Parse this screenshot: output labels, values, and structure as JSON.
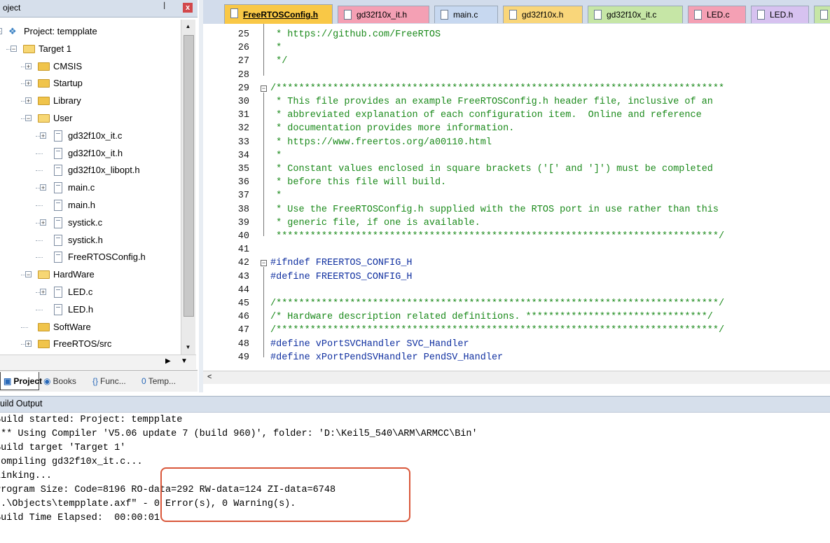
{
  "project_panel": {
    "title": "oject",
    "pin": "ꟾ",
    "close": "x",
    "tree": [
      {
        "label": "Project: tempplate",
        "type": "project",
        "level": 0,
        "expander": "-"
      },
      {
        "label": "Target 1",
        "type": "target",
        "level": 1,
        "expander": "-"
      },
      {
        "label": "CMSIS",
        "type": "folder",
        "level": 2,
        "expander": "+"
      },
      {
        "label": "Startup",
        "type": "folder",
        "level": 2,
        "expander": "+"
      },
      {
        "label": "Library",
        "type": "folder",
        "level": 2,
        "expander": "+"
      },
      {
        "label": "User",
        "type": "folder-open",
        "level": 2,
        "expander": "-"
      },
      {
        "label": "gd32f10x_it.c",
        "type": "file",
        "level": 3,
        "expander": "+"
      },
      {
        "label": "gd32f10x_it.h",
        "type": "file",
        "level": 3,
        "expander": ""
      },
      {
        "label": "gd32f10x_libopt.h",
        "type": "file",
        "level": 3,
        "expander": ""
      },
      {
        "label": "main.c",
        "type": "file",
        "level": 3,
        "expander": "+"
      },
      {
        "label": "main.h",
        "type": "file",
        "level": 3,
        "expander": ""
      },
      {
        "label": "systick.c",
        "type": "file",
        "level": 3,
        "expander": "+"
      },
      {
        "label": "systick.h",
        "type": "file",
        "level": 3,
        "expander": ""
      },
      {
        "label": "FreeRTOSConfig.h",
        "type": "file",
        "level": 3,
        "expander": ""
      },
      {
        "label": "HardWare",
        "type": "folder-open",
        "level": 2,
        "expander": "-"
      },
      {
        "label": "LED.c",
        "type": "file",
        "level": 3,
        "expander": "+"
      },
      {
        "label": "LED.h",
        "type": "file",
        "level": 3,
        "expander": ""
      },
      {
        "label": "SoftWare",
        "type": "folder",
        "level": 2,
        "expander": ""
      },
      {
        "label": "FreeRTOS/src",
        "type": "folder",
        "level": 2,
        "expander": "+"
      }
    ],
    "bottom_tabs": [
      {
        "label": "Project",
        "icon": "project-icon"
      },
      {
        "label": "Books",
        "icon": "books-icon"
      },
      {
        "label": "Func...",
        "icon": "functions-icon",
        "glyph": "{}"
      },
      {
        "label": "Temp...",
        "icon": "templates-icon",
        "glyph": "0"
      }
    ]
  },
  "editor": {
    "tabs": [
      {
        "label": "FreeRTOSConfig.h",
        "color": "#f9c846",
        "active": true
      },
      {
        "label": "gd32f10x_it.h",
        "color": "#f4a0b4",
        "active": false
      },
      {
        "label": "main.c",
        "color": "#c7d8f0",
        "active": false
      },
      {
        "label": "gd32f10x.h",
        "color": "#f9d67a",
        "active": false
      },
      {
        "label": "gd32f10x_it.c",
        "color": "#c6e6a6",
        "active": false
      },
      {
        "label": "LED.c",
        "color": "#f4a0b4",
        "active": false
      },
      {
        "label": "LED.h",
        "color": "#d7c2f0",
        "active": false
      }
    ],
    "lines": [
      {
        "n": "25",
        "text": " * https://github.com/FreeRTOS",
        "kind": "comment"
      },
      {
        "n": "26",
        "text": " *",
        "kind": "comment"
      },
      {
        "n": "27",
        "text": " */",
        "kind": "comment"
      },
      {
        "n": "28",
        "text": "",
        "kind": "comment"
      },
      {
        "n": "29",
        "text": "/*******************************************************************************",
        "kind": "comment",
        "fold": "-"
      },
      {
        "n": "30",
        "text": " * This file provides an example FreeRTOSConfig.h header file, inclusive of an",
        "kind": "comment"
      },
      {
        "n": "31",
        "text": " * abbreviated explanation of each configuration item.  Online and reference",
        "kind": "comment"
      },
      {
        "n": "32",
        "text": " * documentation provides more information.",
        "kind": "comment"
      },
      {
        "n": "33",
        "text": " * https://www.freertos.org/a00110.html",
        "kind": "comment"
      },
      {
        "n": "34",
        "text": " *",
        "kind": "comment"
      },
      {
        "n": "35",
        "text": " * Constant values enclosed in square brackets ('[' and ']') must be completed",
        "kind": "comment"
      },
      {
        "n": "36",
        "text": " * before this file will build.",
        "kind": "comment"
      },
      {
        "n": "37",
        "text": " *",
        "kind": "comment"
      },
      {
        "n": "38",
        "text": " * Use the FreeRTOSConfig.h supplied with the RTOS port in use rather than this",
        "kind": "comment"
      },
      {
        "n": "39",
        "text": " * generic file, if one is available.",
        "kind": "comment"
      },
      {
        "n": "40",
        "text": " ******************************************************************************/",
        "kind": "comment"
      },
      {
        "n": "41",
        "text": "",
        "kind": "comment"
      },
      {
        "n": "42",
        "text": "#ifndef FREERTOS_CONFIG_H",
        "kind": "preproc",
        "fold": "-"
      },
      {
        "n": "43",
        "text": "#define FREERTOS_CONFIG_H",
        "kind": "preproc"
      },
      {
        "n": "44",
        "text": "",
        "kind": "comment"
      },
      {
        "n": "45",
        "text": "/******************************************************************************/",
        "kind": "comment"
      },
      {
        "n": "46",
        "text": "/* Hardware description related definitions. ********************************/",
        "kind": "comment"
      },
      {
        "n": "47",
        "text": "/******************************************************************************/",
        "kind": "comment"
      },
      {
        "n": "48",
        "text": "#define vPortSVCHandler SVC_Handler",
        "kind": "preproc"
      },
      {
        "n": "49",
        "text": "#define xPortPendSVHandler PendSV_Handler",
        "kind": "preproc"
      }
    ]
  },
  "build_output": {
    "title": "uild Output",
    "lines": [
      "Build started: Project: tempplate",
      "*** Using Compiler 'V5.06 update 7 (build 960)', folder: 'D:\\Keil5_540\\ARM\\ARMCC\\Bin'",
      "Build target 'Target 1'",
      "compiling gd32f10x_it.c...",
      "linking...",
      "Program Size: Code=8196 RO-data=292 RW-data=124 ZI-data=6748",
      "\".\\Objects\\tempplate.axf\" - 0 Error(s), 0 Warning(s).",
      "Build Time Elapsed:  00:00:01"
    ],
    "highlight_color": "#d9573a"
  }
}
